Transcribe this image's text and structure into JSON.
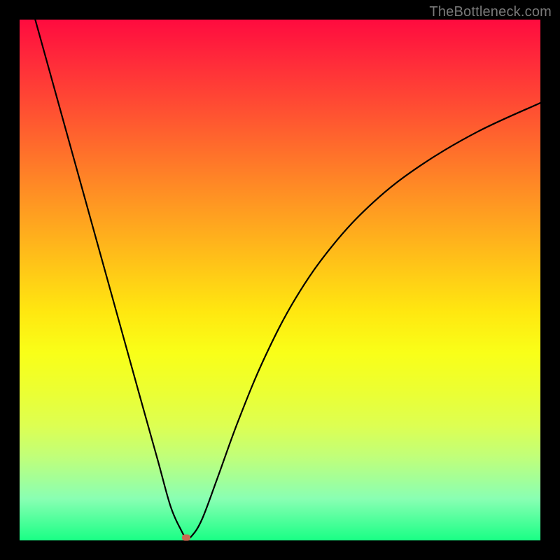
{
  "watermark": "TheBottleneck.com",
  "chart_data": {
    "type": "line",
    "title": "",
    "xlabel": "",
    "ylabel": "",
    "xlim": [
      0,
      100
    ],
    "ylim": [
      0,
      100
    ],
    "grid": false,
    "legend": false,
    "background_gradient": {
      "orientation": "vertical",
      "stops": [
        {
          "pos": 0,
          "color": "#ff0b3f"
        },
        {
          "pos": 50,
          "color": "#ffcf15"
        },
        {
          "pos": 75,
          "color": "#e7ff3a"
        },
        {
          "pos": 100,
          "color": "#19ff85"
        }
      ]
    },
    "series": [
      {
        "name": "curve",
        "x": [
          3.0,
          8.0,
          13.0,
          18.0,
          23.0,
          26.5,
          29.0,
          31.0,
          32.0,
          33.0,
          35.0,
          38.0,
          42.0,
          47.0,
          53.0,
          60.0,
          68.0,
          77.0,
          88.0,
          100.0
        ],
        "y": [
          100.0,
          82.0,
          64.0,
          46.0,
          28.0,
          15.5,
          6.5,
          2.0,
          0.5,
          0.8,
          4.0,
          12.0,
          23.0,
          35.0,
          46.5,
          56.5,
          65.0,
          72.0,
          78.5,
          84.0
        ]
      }
    ],
    "markers": [
      {
        "name": "minimum-marker",
        "x": 32.0,
        "y": 0.5,
        "color": "#c96a50"
      }
    ]
  }
}
